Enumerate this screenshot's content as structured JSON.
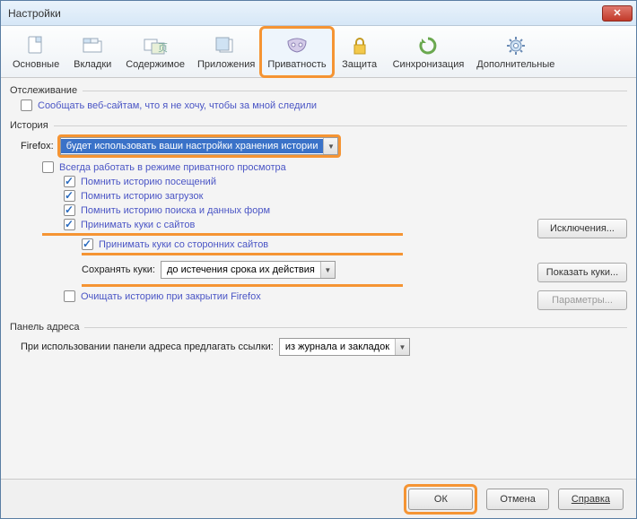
{
  "window": {
    "title": "Настройки"
  },
  "tabs": [
    {
      "id": "general",
      "label": "Основные"
    },
    {
      "id": "tabs",
      "label": "Вкладки"
    },
    {
      "id": "content",
      "label": "Содержимое"
    },
    {
      "id": "apps",
      "label": "Приложения"
    },
    {
      "id": "privacy",
      "label": "Приватность",
      "active": true
    },
    {
      "id": "security",
      "label": "Защита"
    },
    {
      "id": "sync",
      "label": "Синхронизация"
    },
    {
      "id": "advanced",
      "label": "Дополнительные"
    }
  ],
  "tracking": {
    "group": "Отслеживание",
    "dnt_label": "Сообщать веб-сайтам, что я не хочу, чтобы за мной следили",
    "dnt_checked": false
  },
  "history": {
    "group": "История",
    "firefox_label": "Firefox:",
    "mode_value": "будет использовать ваши настройки хранения истории",
    "always_private": {
      "label": "Всегда работать в режиме приватного просмотра",
      "checked": false
    },
    "remember_visits": {
      "label": "Помнить историю посещений",
      "checked": true
    },
    "remember_downloads": {
      "label": "Помнить историю загрузок",
      "checked": true
    },
    "remember_forms": {
      "label": "Помнить историю поиска и данных форм",
      "checked": true
    },
    "accept_cookies": {
      "label": "Принимать куки с сайтов",
      "checked": true
    },
    "accept_third": {
      "label": "Принимать куки со сторонних сайтов",
      "checked": true
    },
    "keep_label": "Сохранять куки:",
    "keep_value": "до истечения срока их действия",
    "clear_on_close": {
      "label": "Очищать историю при закрытии Firefox",
      "checked": false
    },
    "btn_exceptions": "Исключения...",
    "btn_show_cookies": "Показать куки...",
    "btn_params": "Параметры..."
  },
  "addressbar": {
    "group": "Панель адреса",
    "label": "При использовании панели адреса предлагать ссылки:",
    "value": "из журнала и закладок"
  },
  "footer": {
    "ok": "ОК",
    "cancel": "Отмена",
    "help": "Справка"
  }
}
